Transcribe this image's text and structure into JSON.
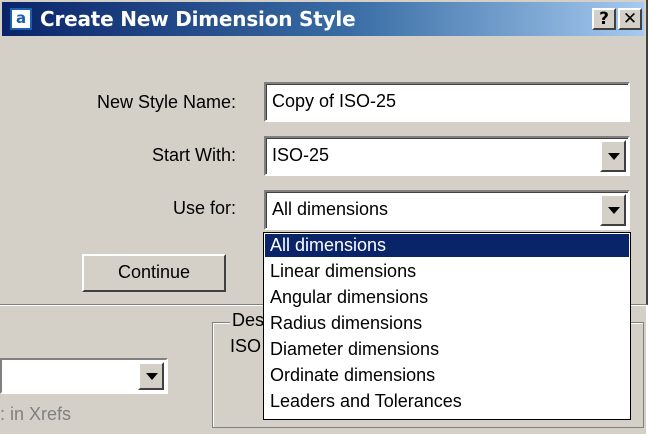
{
  "window": {
    "title": "Create New Dimension Style",
    "icon": "autocad-app-icon",
    "help_glyph": "?",
    "close_glyph": "✕"
  },
  "form": {
    "name_label": "New Style Name:",
    "name_value": "Copy of ISO-25",
    "start_label": "Start With:",
    "start_value": "ISO-25",
    "use_label": "Use for:",
    "use_value": "All dimensions",
    "continue_label": "Continue"
  },
  "use_for_options": [
    "All dimensions",
    "Linear dimensions",
    "Angular dimensions",
    "Radius dimensions",
    "Diameter dimensions",
    "Ordinate dimensions",
    "Leaders and Tolerances"
  ],
  "background": {
    "description_legend": "Des",
    "description_text": "ISO",
    "xrefs_label": ": in Xrefs"
  },
  "colors": {
    "face": "#d4d0c8",
    "title_start": "#0a246a",
    "title_end": "#a6caf0",
    "selection": "#0a246a"
  }
}
